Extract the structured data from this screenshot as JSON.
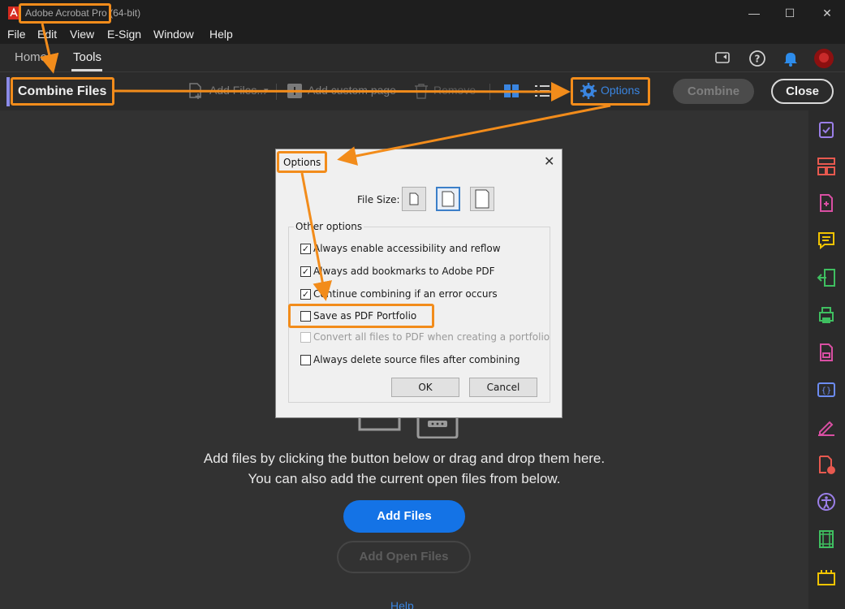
{
  "titlebar": {
    "title": "Adobe Acrobat Pro (64-bit)",
    "minimize": "—",
    "maximize": "☐",
    "close": "✕"
  },
  "menu": [
    "File",
    "Edit",
    "View",
    "E-Sign",
    "Window",
    "Help"
  ],
  "nav": {
    "tabs": [
      "Home",
      "Tools"
    ],
    "active_tab": "Tools",
    "icons": [
      "share-screen-icon",
      "help-icon",
      "notification-bell-icon",
      "avatar"
    ]
  },
  "toolbar": {
    "title": "Combine Files",
    "add_files": "Add Files...",
    "add_files_caret": "▾",
    "add_custom_page": "Add custom page",
    "remove": "Remove",
    "options": "Options",
    "combine": "Combine",
    "close": "Close"
  },
  "main": {
    "line1": "Add files by clicking the button below or drag and drop them here.",
    "line2": "You can also add the current open files from below.",
    "add_files": "Add Files",
    "add_open_files": "Add Open Files",
    "help": "Help"
  },
  "dialog": {
    "title": "Options",
    "file_size_label": "File Size:",
    "group_label": "Other options",
    "checks": [
      {
        "label": "Always enable accessibility and reflow",
        "checked": true,
        "disabled": false
      },
      {
        "label": "Always add bookmarks to Adobe PDF",
        "checked": true,
        "disabled": false
      },
      {
        "label": "Continue combining if an error occurs",
        "checked": true,
        "disabled": false
      },
      {
        "label": "Save as PDF Portfolio",
        "checked": false,
        "disabled": false
      },
      {
        "label": "Convert all files to PDF when creating a portfolio",
        "checked": false,
        "disabled": true
      },
      {
        "label": "Always delete source files after combining",
        "checked": false,
        "disabled": false
      }
    ],
    "ok": "OK",
    "cancel": "Cancel"
  },
  "colors": {
    "accent": "#1473e6",
    "annotation": "#f28c1b",
    "options_blue": "#3a85e0"
  }
}
